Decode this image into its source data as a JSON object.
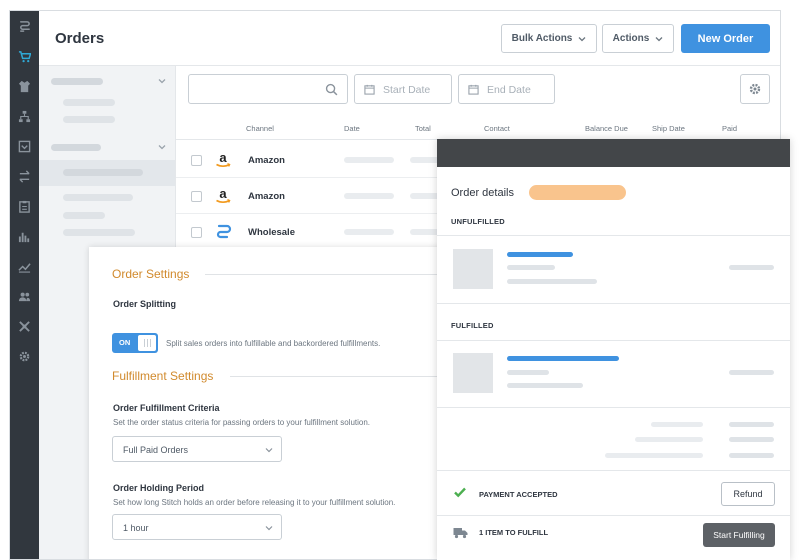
{
  "page": {
    "title": "Orders"
  },
  "header": {
    "bulk_actions_label": "Bulk Actions",
    "actions_label": "Actions",
    "new_order_label": "New Order"
  },
  "rail": {
    "icons": [
      "logo-icon",
      "cart-icon",
      "shirt-icon",
      "hierarchy-icon",
      "inbox-icon",
      "transfer-icon",
      "clipboard-icon",
      "bar-chart-icon",
      "trend-icon",
      "users-icon",
      "integrations-icon",
      "gear-icon"
    ],
    "active_icon": "cart-icon"
  },
  "toolbar": {
    "search_placeholder": "",
    "start_date_placeholder": "Start Date",
    "end_date_placeholder": "End Date"
  },
  "table": {
    "columns": [
      "Channel",
      "Date",
      "Total",
      "Contact",
      "Balance Due",
      "Ship Date",
      "Paid"
    ],
    "rows": [
      {
        "channel": "Amazon",
        "logo": "amazon-logo"
      },
      {
        "channel": "Amazon",
        "logo": "amazon-logo"
      },
      {
        "channel": "Wholesale",
        "logo": "wholesale-logo"
      }
    ]
  },
  "settings": {
    "order_settings_title": "Order Settings",
    "order_splitting_label": "Order Splitting",
    "toggle_state": "ON",
    "order_splitting_desc": "Split sales orders into fulfillable and backordered fulfillments.",
    "fulfillment_settings_title": "Fulfillment Settings",
    "criteria_label": "Order Fulfillment Criteria",
    "criteria_desc": "Set the order status criteria for passing orders to your fulfillment solution.",
    "criteria_value": "Full Paid Orders",
    "holding_label": "Order Holding Period",
    "holding_desc": "Set how long Stitch holds an order before releasing it to your fulfillment solution.",
    "holding_value": "1 hour"
  },
  "details": {
    "title": "Order details",
    "unfulfilled_label": "UNFULFILLED",
    "fulfilled_label": "FULFILLED",
    "payment_label": "PAYMENT ACCEPTED",
    "refund_label": "Refund",
    "fulfill_count_label": "1 ITEM TO FULFILL",
    "start_fulfilling_label": "Start Fulfilling",
    "status_color": "#f9c48d"
  },
  "colors": {
    "accent": "#3f92e0",
    "rail": "#31373e",
    "section_title": "#d18a2d",
    "success": "#4caf50"
  }
}
